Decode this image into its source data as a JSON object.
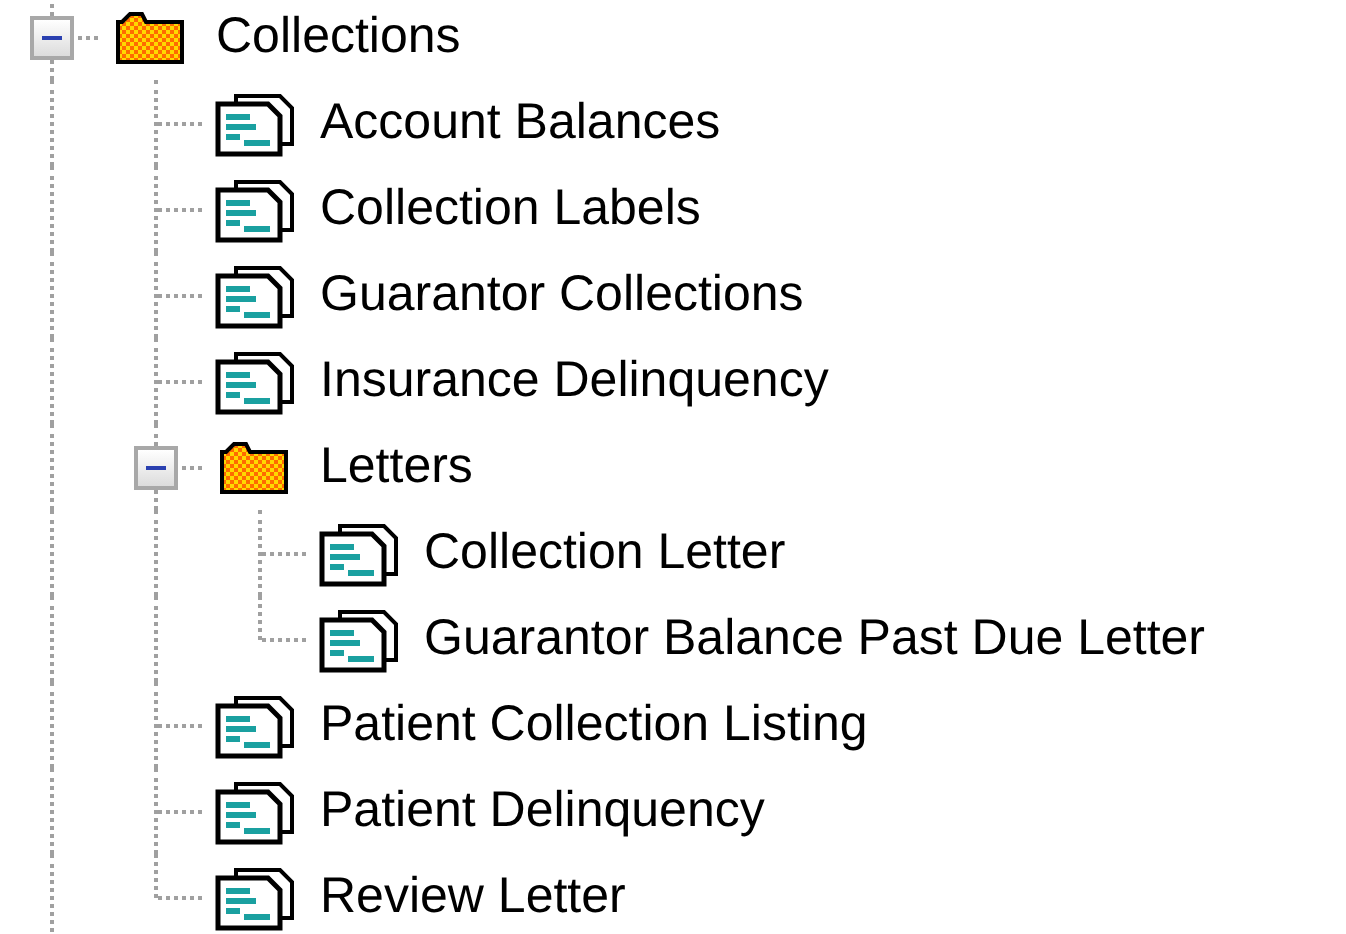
{
  "tree": {
    "items": [
      {
        "label": "Collections",
        "kind": "folder",
        "expanded": true,
        "children": [
          {
            "label": "Account Balances",
            "kind": "report"
          },
          {
            "label": "Collection Labels",
            "kind": "report"
          },
          {
            "label": "Guarantor Collections",
            "kind": "report"
          },
          {
            "label": "Insurance Delinquency",
            "kind": "report"
          },
          {
            "label": "Letters",
            "kind": "folder",
            "expanded": true,
            "children": [
              {
                "label": "Collection Letter",
                "kind": "report"
              },
              {
                "label": "Guarantor Balance Past Due Letter",
                "kind": "report"
              }
            ]
          },
          {
            "label": "Patient Collection Listing",
            "kind": "report"
          },
          {
            "label": "Patient Delinquency",
            "kind": "report"
          },
          {
            "label": "Review Letter",
            "kind": "report"
          }
        ]
      }
    ]
  }
}
